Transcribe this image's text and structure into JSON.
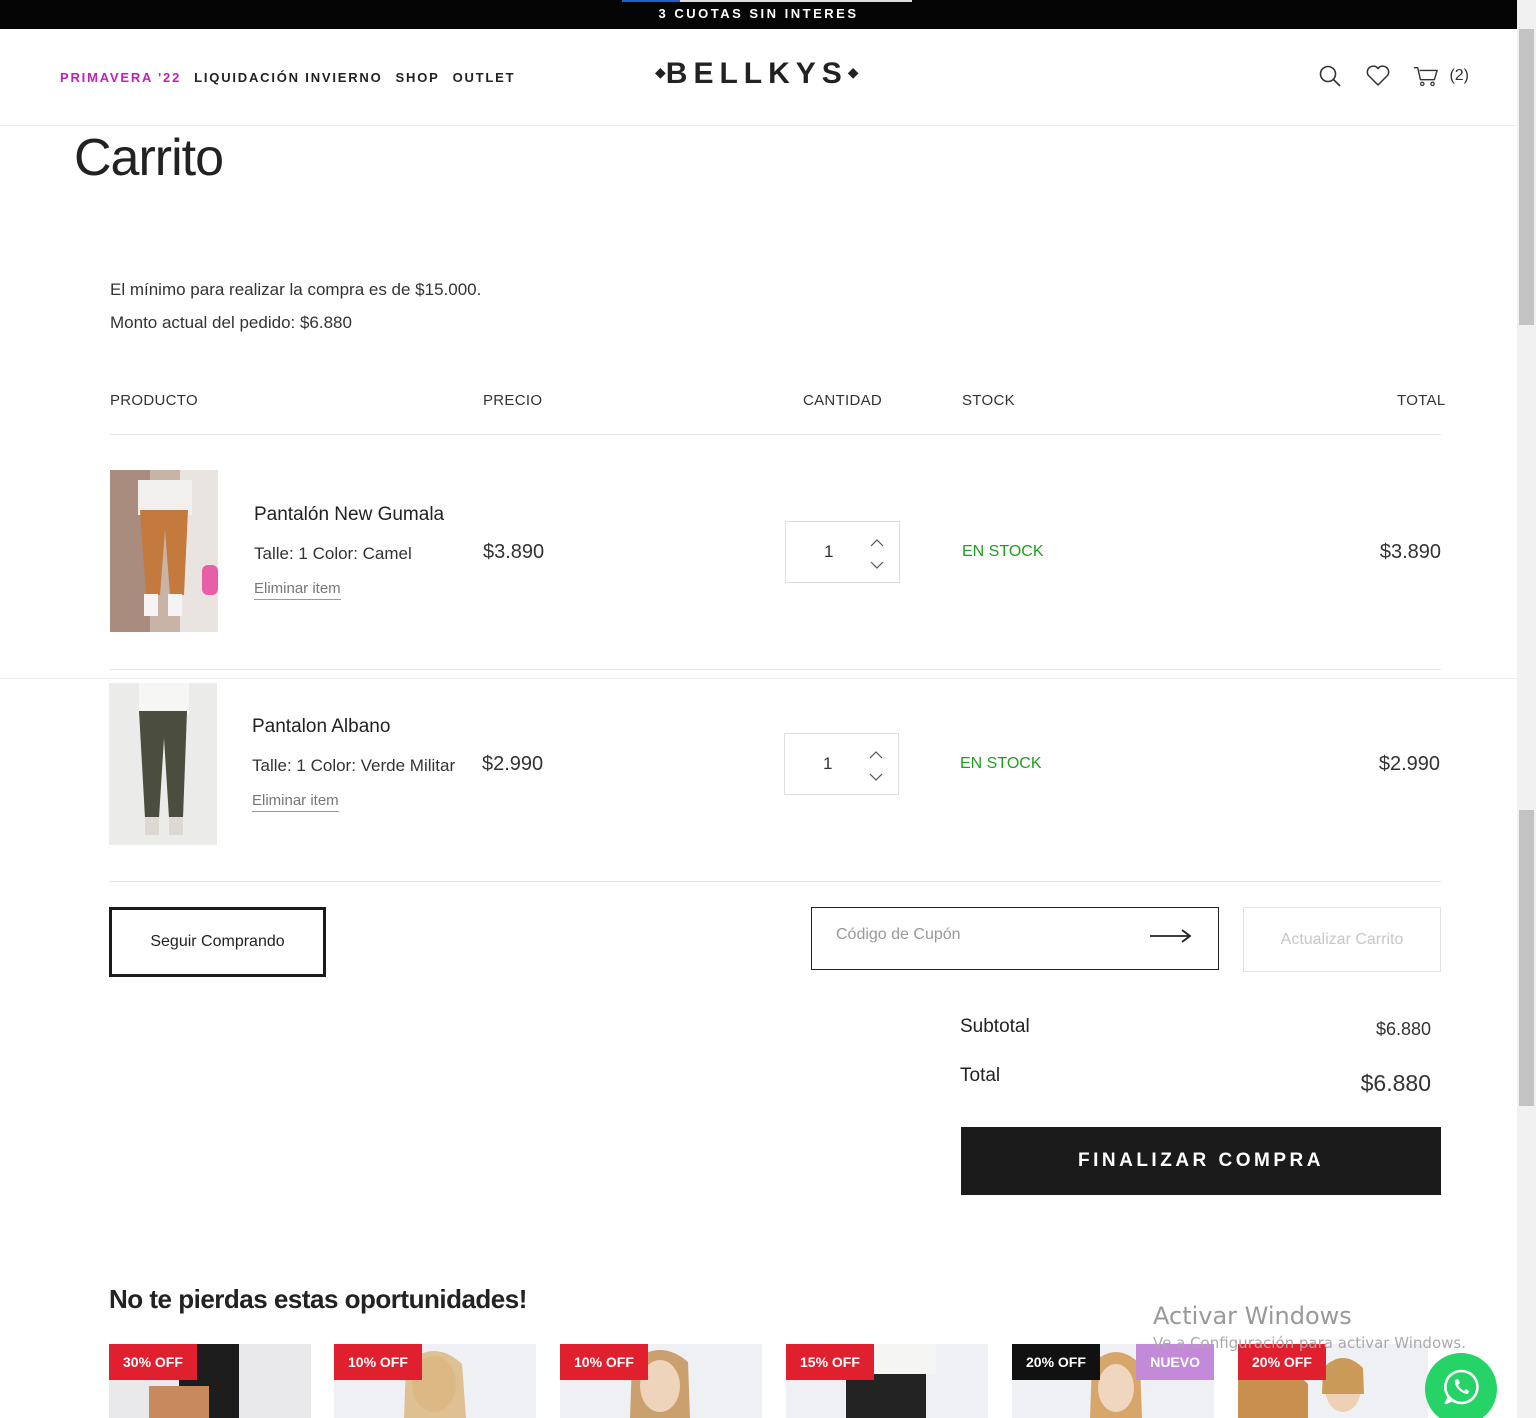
{
  "topbar": {
    "text": "3 CUOTAS SIN INTERES"
  },
  "nav": {
    "items": [
      "PRIMAVERA '22",
      "LIQUIDACIÓN INVIERNO",
      "SHOP",
      "OUTLET"
    ]
  },
  "brand": {
    "name": "BELLKYS"
  },
  "header": {
    "cart_count": "(2)",
    "accent_color": "#c21fb6"
  },
  "page": {
    "title": "Carrito",
    "min_note": "El mínimo para realizar la compra es de $15.000.",
    "current_note": "Monto actual del pedido: $6.880"
  },
  "table": {
    "headers": {
      "product": "PRODUCTO",
      "price": "PRECIO",
      "qty": "CANTIDAD",
      "stock": "STOCK",
      "total": "TOTAL"
    },
    "rows": [
      {
        "name": "Pantalón New Gumala",
        "attrs": "Talle: 1  Color: Camel",
        "remove": "Eliminar item",
        "price": "$3.890",
        "qty": "1",
        "stock": "EN STOCK",
        "total": "$3.890"
      },
      {
        "name": "Pantalon Albano",
        "attrs": "Talle: 1  Color: Verde Militar",
        "remove": "Eliminar item",
        "price": "$2.990",
        "qty": "1",
        "stock": "EN STOCK",
        "total": "$2.990"
      }
    ]
  },
  "actions": {
    "continue": "Seguir Comprando",
    "coupon_placeholder": "Código de Cupón",
    "update": "Actualizar Carrito"
  },
  "summary": {
    "subtotal_label": "Subtotal",
    "subtotal": "$6.880",
    "total_label": "Total",
    "total": "$6.880",
    "checkout": "FINALIZAR COMPRA"
  },
  "recommendations": {
    "title": "No te pierdas estas oportunidades!",
    "badges": [
      "30% OFF",
      "10% OFF",
      "10% OFF",
      "15% OFF",
      "20% OFF",
      "NUEVO",
      "20% OFF"
    ]
  },
  "os_overlay": {
    "title": "Activar Windows",
    "subtitle": "Ve a Configuración para activar Windows."
  }
}
